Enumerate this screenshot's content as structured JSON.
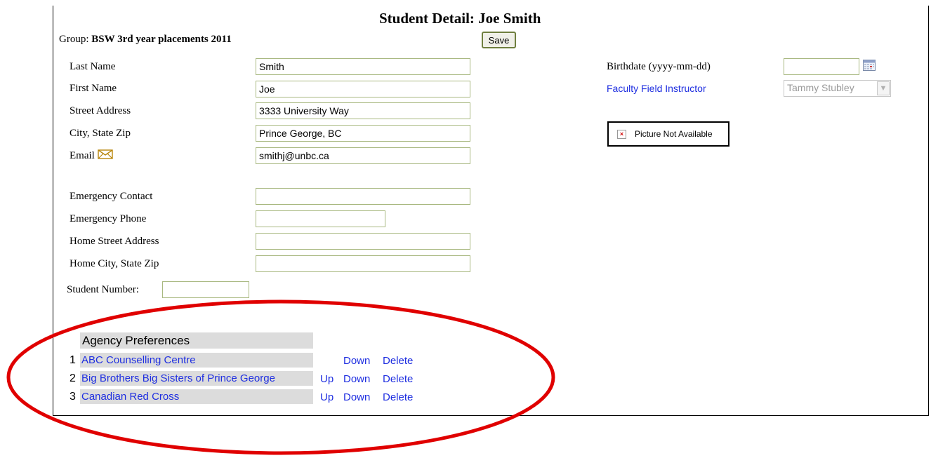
{
  "page": {
    "title": "Student Detail: Joe Smith",
    "group_label": "Group:",
    "group_value": "BSW 3rd year placements 2011",
    "save_label": "Save"
  },
  "form": {
    "last_name": {
      "label": "Last Name",
      "value": "Smith"
    },
    "first_name": {
      "label": "First Name",
      "value": "Joe"
    },
    "street_address": {
      "label": "Street Address",
      "value": "3333 University Way"
    },
    "city_state_zip": {
      "label": "City, State Zip",
      "value": "Prince George, BC"
    },
    "email": {
      "label": "Email",
      "value": "smithj@unbc.ca"
    },
    "emergency_contact": {
      "label": "Emergency Contact",
      "value": ""
    },
    "emergency_phone": {
      "label": "Emergency Phone",
      "value": ""
    },
    "home_street_address": {
      "label": "Home Street Address",
      "value": ""
    },
    "home_city_state_zip": {
      "label": "Home City, State Zip",
      "value": ""
    },
    "student_number": {
      "label": "Student Number:",
      "value": ""
    },
    "birthdate": {
      "label": "Birthdate (yyyy-mm-dd)",
      "value": ""
    },
    "faculty_field_instructor": {
      "label": "Faculty Field Instructor",
      "value": "Tammy Stubley"
    }
  },
  "picture": {
    "text": "Picture Not Available"
  },
  "preferences": {
    "heading": "Agency Preferences",
    "items": [
      {
        "num": "1",
        "name": "ABC Counselling Centre",
        "up": "",
        "down": "Down",
        "delete": "Delete"
      },
      {
        "num": "2",
        "name": "Big Brothers Big Sisters of Prince George",
        "up": "Up",
        "down": "Down",
        "delete": "Delete"
      },
      {
        "num": "3",
        "name": "Canadian Red Cross",
        "up": "Up",
        "down": "Down",
        "delete": "Delete"
      }
    ]
  },
  "colors": {
    "link": "#1e2ee0",
    "annotation": "#e00000",
    "input_border": "#a8b880"
  },
  "icons": {
    "email": "envelope-icon",
    "calendar": "calendar-icon",
    "broken_image": "broken-image-icon"
  }
}
